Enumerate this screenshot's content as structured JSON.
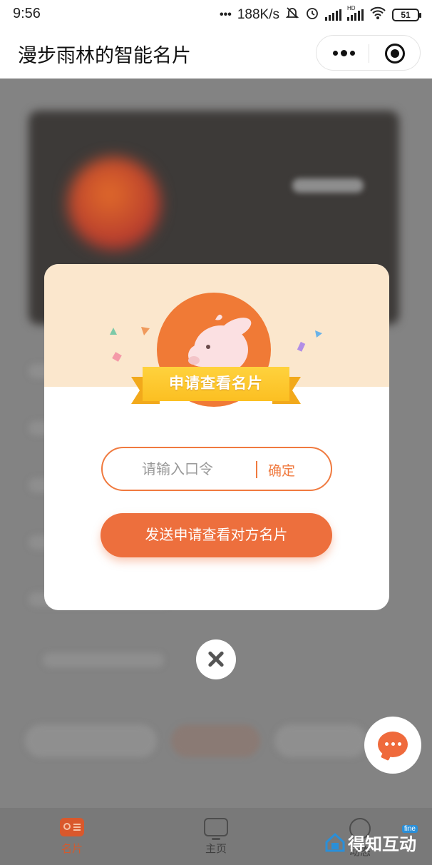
{
  "status_bar": {
    "time": "9:56",
    "more": "•••",
    "net_speed": "188K/s",
    "hd": "HD",
    "battery": "51"
  },
  "title_bar": {
    "title": "漫步雨林的智能名片"
  },
  "modal": {
    "ribbon_label": "申请查看名片",
    "code_placeholder": "请输入口令",
    "code_value": "",
    "confirm_label": "确定",
    "send_label": "发送申请查看对方名片"
  },
  "tabs": [
    {
      "label": "名片",
      "icon": "card-icon",
      "active": true
    },
    {
      "label": "主页",
      "icon": "home-tv-icon",
      "active": false
    },
    {
      "label": "动态",
      "icon": "planet-icon",
      "active": false
    }
  ],
  "watermark": {
    "text": "得知互动",
    "badge": "fine"
  },
  "colors": {
    "accent": "#ed6f3d",
    "ribbon": "#fbbf22",
    "modal_top": "#fbe7cd",
    "overlay": "#7d7d7d"
  }
}
